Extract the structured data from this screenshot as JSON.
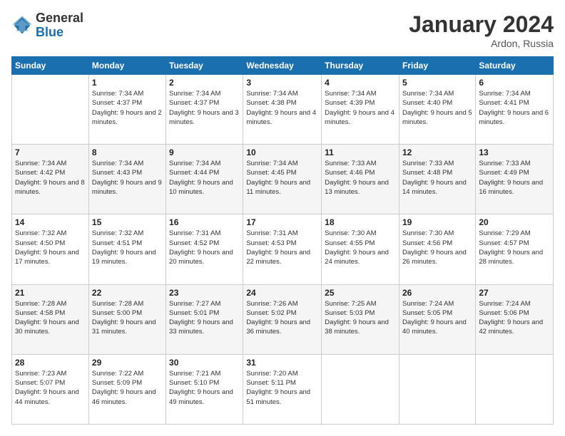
{
  "logo": {
    "general": "General",
    "blue": "Blue"
  },
  "title": "January 2024",
  "location": "Ardon, Russia",
  "days_of_week": [
    "Sunday",
    "Monday",
    "Tuesday",
    "Wednesday",
    "Thursday",
    "Friday",
    "Saturday"
  ],
  "weeks": [
    [
      {
        "day": "",
        "sunrise": "",
        "sunset": "",
        "daylight": ""
      },
      {
        "day": "1",
        "sunrise": "Sunrise: 7:34 AM",
        "sunset": "Sunset: 4:37 PM",
        "daylight": "Daylight: 9 hours and 2 minutes."
      },
      {
        "day": "2",
        "sunrise": "Sunrise: 7:34 AM",
        "sunset": "Sunset: 4:37 PM",
        "daylight": "Daylight: 9 hours and 3 minutes."
      },
      {
        "day": "3",
        "sunrise": "Sunrise: 7:34 AM",
        "sunset": "Sunset: 4:38 PM",
        "daylight": "Daylight: 9 hours and 4 minutes."
      },
      {
        "day": "4",
        "sunrise": "Sunrise: 7:34 AM",
        "sunset": "Sunset: 4:39 PM",
        "daylight": "Daylight: 9 hours and 4 minutes."
      },
      {
        "day": "5",
        "sunrise": "Sunrise: 7:34 AM",
        "sunset": "Sunset: 4:40 PM",
        "daylight": "Daylight: 9 hours and 5 minutes."
      },
      {
        "day": "6",
        "sunrise": "Sunrise: 7:34 AM",
        "sunset": "Sunset: 4:41 PM",
        "daylight": "Daylight: 9 hours and 6 minutes."
      }
    ],
    [
      {
        "day": "7",
        "sunrise": "Sunrise: 7:34 AM",
        "sunset": "Sunset: 4:42 PM",
        "daylight": "Daylight: 9 hours and 8 minutes."
      },
      {
        "day": "8",
        "sunrise": "Sunrise: 7:34 AM",
        "sunset": "Sunset: 4:43 PM",
        "daylight": "Daylight: 9 hours and 9 minutes."
      },
      {
        "day": "9",
        "sunrise": "Sunrise: 7:34 AM",
        "sunset": "Sunset: 4:44 PM",
        "daylight": "Daylight: 9 hours and 10 minutes."
      },
      {
        "day": "10",
        "sunrise": "Sunrise: 7:34 AM",
        "sunset": "Sunset: 4:45 PM",
        "daylight": "Daylight: 9 hours and 11 minutes."
      },
      {
        "day": "11",
        "sunrise": "Sunrise: 7:33 AM",
        "sunset": "Sunset: 4:46 PM",
        "daylight": "Daylight: 9 hours and 13 minutes."
      },
      {
        "day": "12",
        "sunrise": "Sunrise: 7:33 AM",
        "sunset": "Sunset: 4:48 PM",
        "daylight": "Daylight: 9 hours and 14 minutes."
      },
      {
        "day": "13",
        "sunrise": "Sunrise: 7:33 AM",
        "sunset": "Sunset: 4:49 PM",
        "daylight": "Daylight: 9 hours and 16 minutes."
      }
    ],
    [
      {
        "day": "14",
        "sunrise": "Sunrise: 7:32 AM",
        "sunset": "Sunset: 4:50 PM",
        "daylight": "Daylight: 9 hours and 17 minutes."
      },
      {
        "day": "15",
        "sunrise": "Sunrise: 7:32 AM",
        "sunset": "Sunset: 4:51 PM",
        "daylight": "Daylight: 9 hours and 19 minutes."
      },
      {
        "day": "16",
        "sunrise": "Sunrise: 7:31 AM",
        "sunset": "Sunset: 4:52 PM",
        "daylight": "Daylight: 9 hours and 20 minutes."
      },
      {
        "day": "17",
        "sunrise": "Sunrise: 7:31 AM",
        "sunset": "Sunset: 4:53 PM",
        "daylight": "Daylight: 9 hours and 22 minutes."
      },
      {
        "day": "18",
        "sunrise": "Sunrise: 7:30 AM",
        "sunset": "Sunset: 4:55 PM",
        "daylight": "Daylight: 9 hours and 24 minutes."
      },
      {
        "day": "19",
        "sunrise": "Sunrise: 7:30 AM",
        "sunset": "Sunset: 4:56 PM",
        "daylight": "Daylight: 9 hours and 26 minutes."
      },
      {
        "day": "20",
        "sunrise": "Sunrise: 7:29 AM",
        "sunset": "Sunset: 4:57 PM",
        "daylight": "Daylight: 9 hours and 28 minutes."
      }
    ],
    [
      {
        "day": "21",
        "sunrise": "Sunrise: 7:28 AM",
        "sunset": "Sunset: 4:58 PM",
        "daylight": "Daylight: 9 hours and 30 minutes."
      },
      {
        "day": "22",
        "sunrise": "Sunrise: 7:28 AM",
        "sunset": "Sunset: 5:00 PM",
        "daylight": "Daylight: 9 hours and 31 minutes."
      },
      {
        "day": "23",
        "sunrise": "Sunrise: 7:27 AM",
        "sunset": "Sunset: 5:01 PM",
        "daylight": "Daylight: 9 hours and 33 minutes."
      },
      {
        "day": "24",
        "sunrise": "Sunrise: 7:26 AM",
        "sunset": "Sunset: 5:02 PM",
        "daylight": "Daylight: 9 hours and 36 minutes."
      },
      {
        "day": "25",
        "sunrise": "Sunrise: 7:25 AM",
        "sunset": "Sunset: 5:03 PM",
        "daylight": "Daylight: 9 hours and 38 minutes."
      },
      {
        "day": "26",
        "sunrise": "Sunrise: 7:24 AM",
        "sunset": "Sunset: 5:05 PM",
        "daylight": "Daylight: 9 hours and 40 minutes."
      },
      {
        "day": "27",
        "sunrise": "Sunrise: 7:24 AM",
        "sunset": "Sunset: 5:06 PM",
        "daylight": "Daylight: 9 hours and 42 minutes."
      }
    ],
    [
      {
        "day": "28",
        "sunrise": "Sunrise: 7:23 AM",
        "sunset": "Sunset: 5:07 PM",
        "daylight": "Daylight: 9 hours and 44 minutes."
      },
      {
        "day": "29",
        "sunrise": "Sunrise: 7:22 AM",
        "sunset": "Sunset: 5:09 PM",
        "daylight": "Daylight: 9 hours and 46 minutes."
      },
      {
        "day": "30",
        "sunrise": "Sunrise: 7:21 AM",
        "sunset": "Sunset: 5:10 PM",
        "daylight": "Daylight: 9 hours and 49 minutes."
      },
      {
        "day": "31",
        "sunrise": "Sunrise: 7:20 AM",
        "sunset": "Sunset: 5:11 PM",
        "daylight": "Daylight: 9 hours and 51 minutes."
      },
      {
        "day": "",
        "sunrise": "",
        "sunset": "",
        "daylight": ""
      },
      {
        "day": "",
        "sunrise": "",
        "sunset": "",
        "daylight": ""
      },
      {
        "day": "",
        "sunrise": "",
        "sunset": "",
        "daylight": ""
      }
    ]
  ]
}
